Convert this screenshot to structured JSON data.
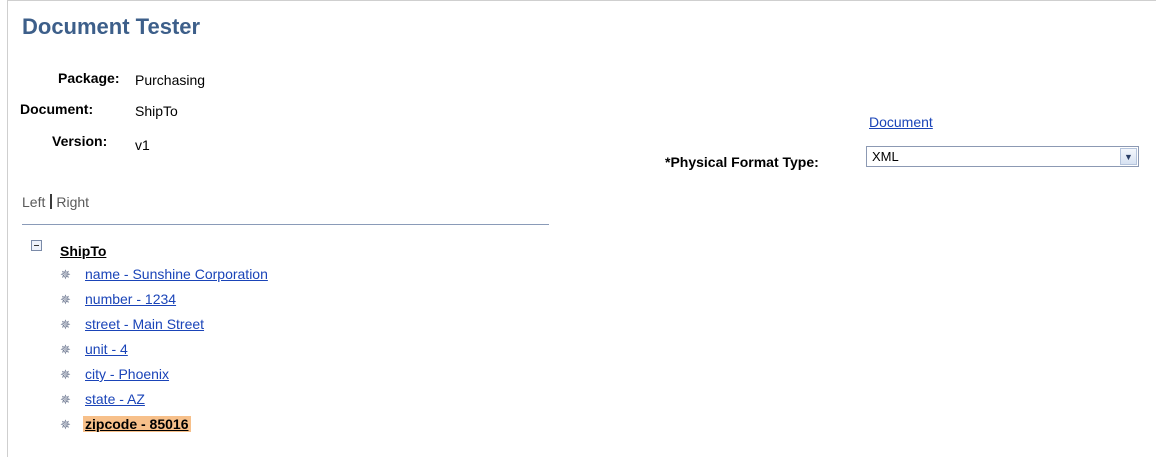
{
  "page": {
    "title": "Document Tester"
  },
  "fields": {
    "package": {
      "label": "Package:",
      "value": "Purchasing"
    },
    "document": {
      "label": "Document:",
      "value": "ShipTo"
    },
    "version": {
      "label": "Version:",
      "value": "v1"
    }
  },
  "document_link": "Document",
  "physical_format": {
    "label": "*Physical Format Type:",
    "value": "XML"
  },
  "view_tabs": {
    "left": "Left",
    "right": "Right"
  },
  "tree": {
    "root": "ShipTo",
    "items": [
      {
        "label": "name - Sunshine Corporation",
        "selected": false
      },
      {
        "label": "number - 1234",
        "selected": false
      },
      {
        "label": "street - Main Street",
        "selected": false
      },
      {
        "label": "unit - 4",
        "selected": false
      },
      {
        "label": "city - Phoenix",
        "selected": false
      },
      {
        "label": "state - AZ",
        "selected": false
      },
      {
        "label": "zipcode - 85016",
        "selected": true
      }
    ]
  },
  "colors": {
    "title": "#3d5f8a",
    "link": "#1a44b8",
    "selected_highlight": "#f7c08a"
  },
  "icons": {
    "collapse": "minus-box-icon",
    "node": "node-star-icon",
    "dropdown": "chevron-down-icon"
  }
}
